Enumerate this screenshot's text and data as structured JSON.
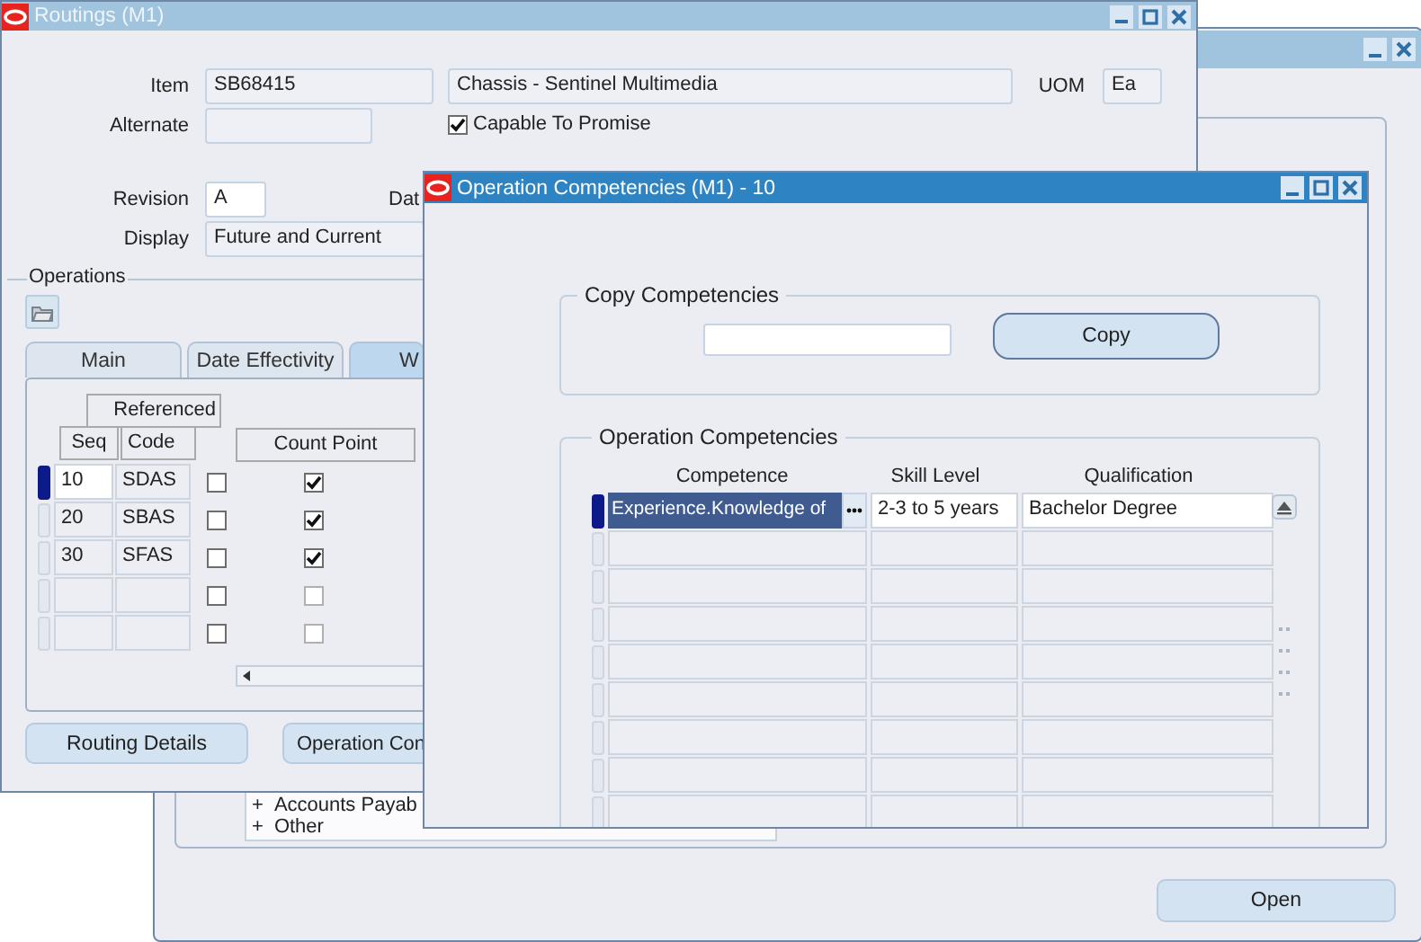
{
  "navigator_window": {
    "tree_items": [
      {
        "toggle": "+",
        "label": "Accounts Payab"
      },
      {
        "toggle": "+",
        "label": "Other"
      }
    ],
    "open_button": "Open"
  },
  "routings": {
    "title": "Routings (M1)",
    "item": {
      "label": "Item",
      "value": "SB68415",
      "description": "Chassis - Sentinel Multimedia"
    },
    "uom": {
      "label": "UOM",
      "value": "Ea"
    },
    "alternate": {
      "label": "Alternate"
    },
    "capable_to_promise": {
      "label": "Capable To Promise",
      "checked": true
    },
    "revision": {
      "label": "Revision",
      "value": "A"
    },
    "date_label": "Dat",
    "display": {
      "label": "Display",
      "value": "Future and Current"
    },
    "operations": {
      "label": "Operations",
      "tabs": [
        {
          "label": "Main",
          "selected": false
        },
        {
          "label": "Date Effectivity",
          "selected": false
        },
        {
          "label": "W",
          "selected": true
        }
      ],
      "columns": {
        "group": "Referenced",
        "seq": "Seq",
        "code": "Code",
        "count_point": "Count Point"
      },
      "rows": [
        {
          "seq": "10",
          "code": "SDAS",
          "referenced": false,
          "count_point": true,
          "current": true,
          "enabled": true
        },
        {
          "seq": "20",
          "code": "SBAS",
          "referenced": false,
          "count_point": true,
          "current": false,
          "enabled": true
        },
        {
          "seq": "30",
          "code": "SFAS",
          "referenced": false,
          "count_point": true,
          "current": false,
          "enabled": true
        },
        {
          "referenced": false,
          "count_point": false,
          "current": false,
          "enabled": false
        },
        {
          "referenced": false,
          "count_point": false,
          "current": false,
          "enabled": false
        }
      ]
    },
    "buttons": [
      "Routing Details",
      "Operation Con"
    ]
  },
  "competencies_dialog": {
    "title": "Operation Competencies (M1) - 10",
    "copy": {
      "label": "Copy Competencies",
      "button": "Copy"
    },
    "list": {
      "label": "Operation Competencies",
      "columns": [
        "Competence",
        "Skill Level",
        "Qualification"
      ],
      "rows": [
        {
          "competence": "Experience.Knowledge of",
          "skill_level": "2-3 to 5 years",
          "qualification": "Bachelor Degree",
          "current": true
        },
        {
          "current": false
        },
        {
          "current": false
        },
        {
          "current": false
        },
        {
          "current": false
        },
        {
          "current": false
        },
        {
          "current": false
        },
        {
          "current": false
        },
        {
          "current": false
        }
      ]
    }
  }
}
